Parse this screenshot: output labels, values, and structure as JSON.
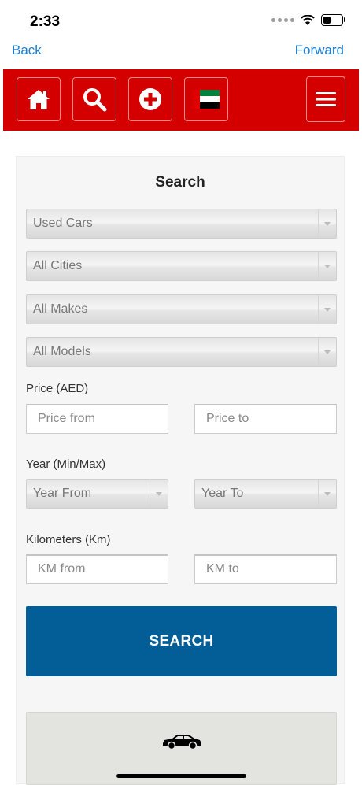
{
  "status_bar": {
    "time": "2:33"
  },
  "browser": {
    "back_label": "Back",
    "forward_label": "Forward"
  },
  "header": {
    "buttons": [
      "home-icon",
      "search-icon",
      "add-icon",
      "uae-flag-icon",
      "menu-icon"
    ],
    "brand_color": "#d40000"
  },
  "search": {
    "title": "Search",
    "category_select": "Used Cars",
    "city_select": "All Cities",
    "make_select": "All Makes",
    "model_select": "All Models",
    "price_label": "Price (AED)",
    "price_from_placeholder": "Price from",
    "price_to_placeholder": "Price to",
    "year_label": "Year (Min/Max)",
    "year_from_select": "Year From",
    "year_to_select": "Year To",
    "km_label": "Kilometers (Km)",
    "km_from_placeholder": "KM from",
    "km_to_placeholder": "KM to",
    "submit_label": "SEARCH",
    "button_color": "#035d96"
  }
}
